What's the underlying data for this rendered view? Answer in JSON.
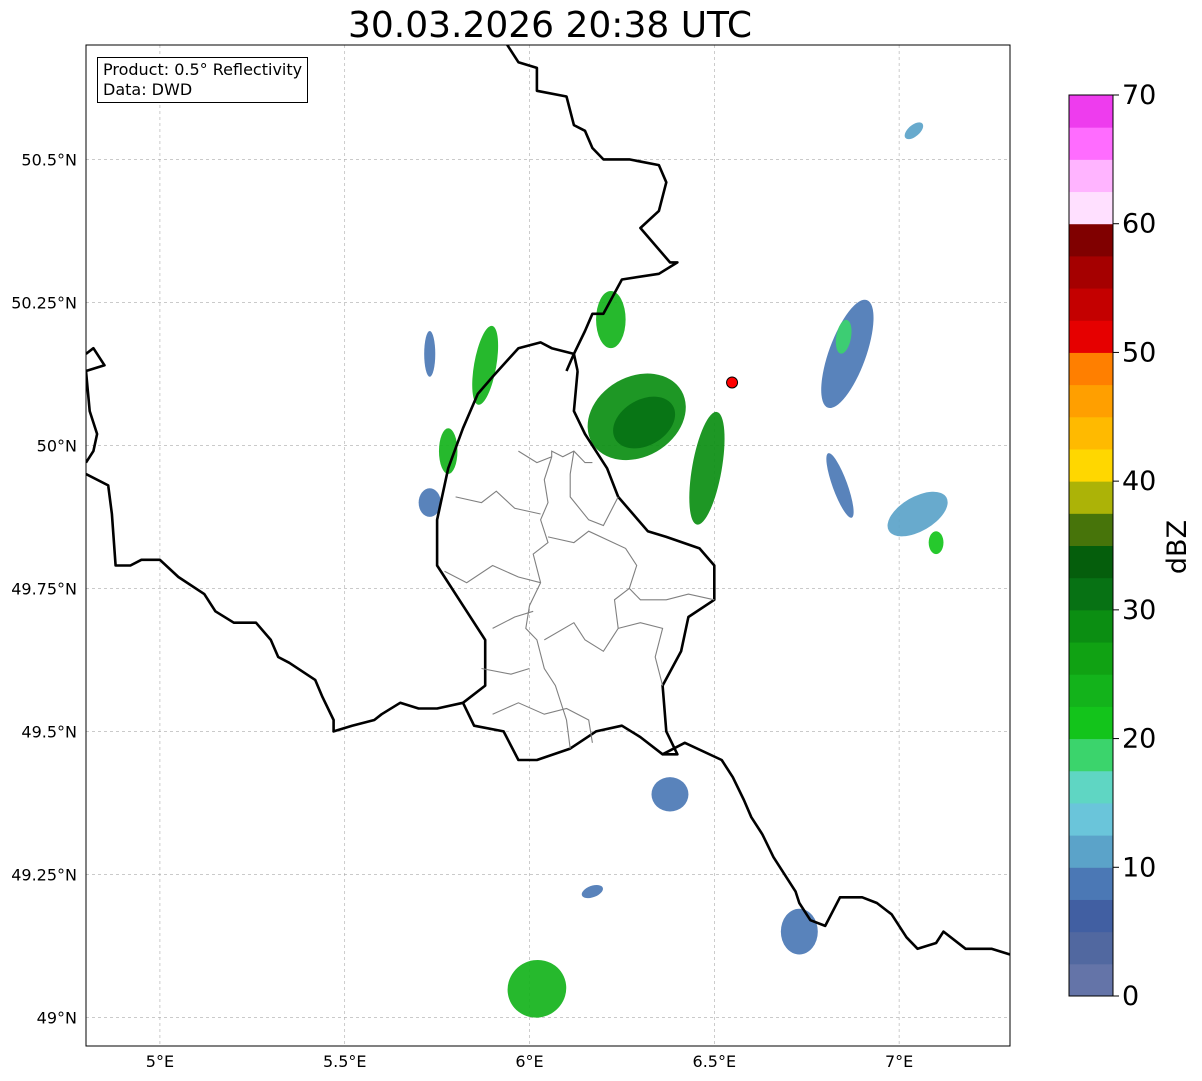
{
  "title": "30.03.2026 20:38 UTC",
  "info_box": {
    "product": "Product: 0.5° Reflectivity",
    "data": "Data: DWD"
  },
  "map": {
    "lon_range": [
      4.8,
      7.3
    ],
    "lat_range": [
      48.95,
      50.7
    ],
    "x_ticks": [
      {
        "value": 5.0,
        "label": "5°E"
      },
      {
        "value": 5.5,
        "label": "5.5°E"
      },
      {
        "value": 6.0,
        "label": "6°E"
      },
      {
        "value": 6.5,
        "label": "6.5°E"
      },
      {
        "value": 7.0,
        "label": "7°E"
      }
    ],
    "y_ticks": [
      {
        "value": 50.5,
        "label": "50.5°N"
      },
      {
        "value": 50.25,
        "label": "50.25°N"
      },
      {
        "value": 50.0,
        "label": "50°N"
      },
      {
        "value": 49.75,
        "label": "49.75°N"
      },
      {
        "value": 49.5,
        "label": "49.5°N"
      },
      {
        "value": 49.25,
        "label": "49.25°N"
      },
      {
        "value": 49.0,
        "label": "49°N"
      }
    ],
    "grid": true,
    "radar_site": {
      "lon": 6.548,
      "lat": 50.11,
      "color": "#ff0000"
    },
    "borders": {
      "france_belgium": [
        [
          4.8,
          50.16
        ],
        [
          4.82,
          50.17
        ],
        [
          4.85,
          50.14
        ],
        [
          4.8,
          50.13
        ],
        [
          4.81,
          50.06
        ],
        [
          4.83,
          50.02
        ],
        [
          4.82,
          49.99
        ],
        [
          4.8,
          49.97
        ]
      ],
      "belgium_france": [
        [
          4.8,
          49.95
        ],
        [
          4.86,
          49.93
        ],
        [
          4.87,
          49.88
        ],
        [
          4.88,
          49.79
        ],
        [
          4.92,
          49.79
        ],
        [
          4.95,
          49.8
        ],
        [
          5.0,
          49.8
        ],
        [
          5.05,
          49.77
        ],
        [
          5.12,
          49.74
        ],
        [
          5.15,
          49.71
        ],
        [
          5.2,
          49.69
        ],
        [
          5.26,
          49.69
        ],
        [
          5.3,
          49.66
        ],
        [
          5.32,
          49.63
        ],
        [
          5.35,
          49.62
        ],
        [
          5.42,
          49.59
        ],
        [
          5.44,
          49.56
        ],
        [
          5.47,
          49.52
        ],
        [
          5.47,
          49.5
        ],
        [
          5.52,
          49.51
        ],
        [
          5.58,
          49.52
        ],
        [
          5.6,
          49.53
        ],
        [
          5.65,
          49.55
        ],
        [
          5.7,
          49.54
        ],
        [
          5.75,
          49.54
        ],
        [
          5.82,
          49.55
        ]
      ],
      "belgium_germany": [
        [
          5.93,
          50.71
        ],
        [
          5.97,
          50.67
        ],
        [
          6.02,
          50.66
        ],
        [
          6.02,
          50.62
        ],
        [
          6.1,
          50.61
        ],
        [
          6.12,
          50.56
        ],
        [
          6.15,
          50.55
        ],
        [
          6.17,
          50.52
        ],
        [
          6.2,
          50.5
        ],
        [
          6.27,
          50.5
        ],
        [
          6.35,
          50.49
        ],
        [
          6.37,
          50.46
        ],
        [
          6.35,
          50.41
        ],
        [
          6.3,
          50.38
        ],
        [
          6.38,
          50.32
        ],
        [
          6.4,
          50.32
        ],
        [
          6.35,
          50.3
        ],
        [
          6.25,
          50.29
        ],
        [
          6.2,
          50.23
        ],
        [
          6.17,
          50.23
        ],
        [
          6.15,
          50.2
        ],
        [
          6.12,
          50.16
        ],
        [
          6.1,
          50.13
        ]
      ],
      "lux_outline": [
        [
          6.13,
          50.13
        ],
        [
          6.12,
          50.16
        ],
        [
          6.06,
          50.17
        ],
        [
          6.03,
          50.18
        ],
        [
          5.97,
          50.17
        ],
        [
          5.9,
          50.12
        ],
        [
          5.86,
          50.09
        ],
        [
          5.82,
          50.03
        ],
        [
          5.78,
          49.96
        ],
        [
          5.75,
          49.87
        ],
        [
          5.75,
          49.79
        ],
        [
          5.82,
          49.72
        ],
        [
          5.88,
          49.66
        ],
        [
          5.88,
          49.58
        ],
        [
          5.82,
          49.55
        ],
        [
          5.85,
          49.51
        ],
        [
          5.93,
          49.5
        ],
        [
          5.97,
          49.45
        ],
        [
          6.02,
          49.45
        ],
        [
          6.11,
          49.47
        ],
        [
          6.18,
          49.5
        ],
        [
          6.25,
          49.51
        ],
        [
          6.3,
          49.49
        ],
        [
          6.36,
          49.46
        ],
        [
          6.4,
          49.46
        ],
        [
          6.37,
          49.5
        ],
        [
          6.36,
          49.58
        ],
        [
          6.41,
          49.64
        ],
        [
          6.43,
          49.7
        ],
        [
          6.5,
          49.73
        ],
        [
          6.5,
          49.79
        ],
        [
          6.46,
          49.82
        ],
        [
          6.37,
          49.84
        ],
        [
          6.32,
          49.85
        ],
        [
          6.24,
          49.91
        ],
        [
          6.21,
          49.96
        ],
        [
          6.15,
          50.02
        ],
        [
          6.12,
          50.06
        ],
        [
          6.13,
          50.13
        ]
      ],
      "germany_france": [
        [
          6.36,
          49.46
        ],
        [
          6.42,
          49.48
        ],
        [
          6.52,
          49.45
        ],
        [
          6.55,
          49.42
        ],
        [
          6.58,
          49.38
        ],
        [
          6.6,
          49.35
        ],
        [
          6.63,
          49.32
        ],
        [
          6.66,
          49.28
        ],
        [
          6.7,
          49.24
        ],
        [
          6.72,
          49.22
        ],
        [
          6.73,
          49.2
        ],
        [
          6.76,
          49.17
        ],
        [
          6.8,
          49.16
        ],
        [
          6.84,
          49.21
        ],
        [
          6.9,
          49.21
        ],
        [
          6.94,
          49.2
        ],
        [
          6.98,
          49.18
        ],
        [
          7.02,
          49.14
        ],
        [
          7.05,
          49.12
        ],
        [
          7.1,
          49.13
        ],
        [
          7.12,
          49.15
        ],
        [
          7.18,
          49.12
        ],
        [
          7.25,
          49.12
        ],
        [
          7.3,
          49.11
        ]
      ],
      "internal": [
        [
          [
            5.97,
            49.99
          ],
          [
            6.02,
            49.97
          ],
          [
            6.06,
            49.98
          ],
          [
            6.06,
            49.99
          ],
          [
            6.09,
            49.98
          ],
          [
            6.12,
            49.99
          ],
          [
            6.15,
            49.97
          ],
          [
            6.17,
            49.97
          ]
        ],
        [
          [
            6.06,
            49.98
          ],
          [
            6.04,
            49.94
          ],
          [
            6.05,
            49.9
          ],
          [
            6.03,
            49.87
          ],
          [
            6.05,
            49.83
          ],
          [
            6.01,
            49.81
          ],
          [
            6.03,
            49.76
          ],
          [
            6.0,
            49.72
          ],
          [
            5.99,
            49.68
          ],
          [
            6.02,
            49.66
          ],
          [
            6.04,
            49.61
          ],
          [
            6.07,
            49.58
          ],
          [
            6.1,
            49.52
          ],
          [
            6.11,
            49.47
          ]
        ],
        [
          [
            6.12,
            49.99
          ],
          [
            6.11,
            49.95
          ],
          [
            6.11,
            49.91
          ],
          [
            6.16,
            49.87
          ],
          [
            6.2,
            49.86
          ],
          [
            6.24,
            49.91
          ]
        ],
        [
          [
            5.8,
            49.91
          ],
          [
            5.87,
            49.9
          ],
          [
            5.91,
            49.92
          ],
          [
            5.96,
            49.89
          ],
          [
            6.03,
            49.88
          ]
        ],
        [
          [
            5.77,
            49.78
          ],
          [
            5.83,
            49.76
          ],
          [
            5.9,
            49.79
          ],
          [
            5.97,
            49.77
          ],
          [
            6.03,
            49.76
          ]
        ],
        [
          [
            5.9,
            49.68
          ],
          [
            5.96,
            49.7
          ],
          [
            6.01,
            49.71
          ]
        ],
        [
          [
            6.05,
            49.84
          ],
          [
            6.12,
            49.83
          ],
          [
            6.16,
            49.85
          ],
          [
            6.26,
            49.82
          ],
          [
            6.29,
            49.79
          ],
          [
            6.27,
            49.75
          ],
          [
            6.3,
            49.73
          ],
          [
            6.37,
            49.73
          ],
          [
            6.43,
            49.74
          ],
          [
            6.5,
            49.73
          ]
        ],
        [
          [
            6.27,
            49.75
          ],
          [
            6.23,
            49.73
          ],
          [
            6.24,
            49.68
          ],
          [
            6.2,
            49.64
          ],
          [
            6.15,
            49.66
          ],
          [
            6.12,
            49.69
          ],
          [
            6.04,
            49.66
          ]
        ],
        [
          [
            6.24,
            49.68
          ],
          [
            6.3,
            49.69
          ],
          [
            6.36,
            49.68
          ],
          [
            6.34,
            49.63
          ],
          [
            6.36,
            49.58
          ]
        ],
        [
          [
            5.87,
            49.61
          ],
          [
            5.95,
            49.6
          ],
          [
            6.0,
            49.61
          ]
        ],
        [
          [
            5.9,
            49.53
          ],
          [
            5.97,
            49.55
          ],
          [
            6.04,
            49.53
          ],
          [
            6.1,
            49.54
          ],
          [
            6.16,
            49.52
          ],
          [
            6.17,
            49.48
          ]
        ]
      ]
    },
    "echoes": [
      {
        "lon": 6.29,
        "lat": 50.05,
        "rx": 0.14,
        "ry": 0.07,
        "rot": -30,
        "color": "#0b8e12"
      },
      {
        "lon": 6.31,
        "lat": 50.04,
        "rx": 0.09,
        "ry": 0.04,
        "rot": -30,
        "color": "#077214"
      },
      {
        "lon": 6.48,
        "lat": 49.96,
        "rx": 0.04,
        "ry": 0.1,
        "rot": 10,
        "color": "#0b8e12"
      },
      {
        "lon": 6.22,
        "lat": 50.22,
        "rx": 0.04,
        "ry": 0.05,
        "rot": 0,
        "color": "#13b31b"
      },
      {
        "lon": 5.88,
        "lat": 50.14,
        "rx": 0.03,
        "ry": 0.07,
        "rot": 10,
        "color": "#13b31b"
      },
      {
        "lon": 5.78,
        "lat": 49.99,
        "rx": 0.025,
        "ry": 0.04,
        "rot": 0,
        "color": "#13b31b"
      },
      {
        "lon": 5.73,
        "lat": 49.9,
        "rx": 0.03,
        "ry": 0.025,
        "rot": 0,
        "color": "#4b78b5"
      },
      {
        "lon": 5.73,
        "lat": 50.16,
        "rx": 0.015,
        "ry": 0.04,
        "rot": 0,
        "color": "#4b78b5"
      },
      {
        "lon": 6.86,
        "lat": 50.16,
        "rx": 0.05,
        "ry": 0.1,
        "rot": 20,
        "color": "#4b78b5"
      },
      {
        "lon": 6.85,
        "lat": 50.19,
        "rx": 0.02,
        "ry": 0.03,
        "rot": 10,
        "color": "#3bd46c"
      },
      {
        "lon": 6.84,
        "lat": 49.93,
        "rx": 0.02,
        "ry": 0.06,
        "rot": -20,
        "color": "#4b78b5"
      },
      {
        "lon": 7.05,
        "lat": 49.88,
        "rx": 0.09,
        "ry": 0.03,
        "rot": -30,
        "color": "#5ba3c9"
      },
      {
        "lon": 7.1,
        "lat": 49.83,
        "rx": 0.02,
        "ry": 0.02,
        "rot": 0,
        "color": "#13c41b"
      },
      {
        "lon": 7.04,
        "lat": 50.55,
        "rx": 0.03,
        "ry": 0.01,
        "rot": -40,
        "color": "#5ba3c9"
      },
      {
        "lon": 6.38,
        "lat": 49.39,
        "rx": 0.05,
        "ry": 0.03,
        "rot": 0,
        "color": "#4b78b5"
      },
      {
        "lon": 6.73,
        "lat": 49.15,
        "rx": 0.05,
        "ry": 0.04,
        "rot": 0,
        "color": "#4b78b5"
      },
      {
        "lon": 6.02,
        "lat": 49.05,
        "rx": 0.08,
        "ry": 0.05,
        "rot": -30,
        "color": "#13b31b"
      },
      {
        "lon": 6.17,
        "lat": 49.22,
        "rx": 0.03,
        "ry": 0.01,
        "rot": -20,
        "color": "#4b78b5"
      }
    ]
  },
  "colorbar": {
    "label": "dBZ",
    "vmin": 0,
    "vmax": 70,
    "step": 2.5,
    "tick_labels": [
      "0",
      "10",
      "20",
      "30",
      "40",
      "50",
      "60",
      "70"
    ],
    "colors": [
      "#6474a8",
      "#5168a0",
      "#415fa2",
      "#4b78b5",
      "#5ba3c9",
      "#6ac5da",
      "#5fd6c3",
      "#3bd46c",
      "#13c41b",
      "#13b31b",
      "#10a213",
      "#0b8e12",
      "#077214",
      "#055e0c",
      "#47740a",
      "#acb307",
      "#ffd700",
      "#ffba00",
      "#ff9f00",
      "#ff7f00",
      "#e60000",
      "#c40000",
      "#a50000",
      "#800000",
      "#ffe0ff",
      "#ffb4ff",
      "#ff6cff",
      "#ee3cee"
    ]
  }
}
